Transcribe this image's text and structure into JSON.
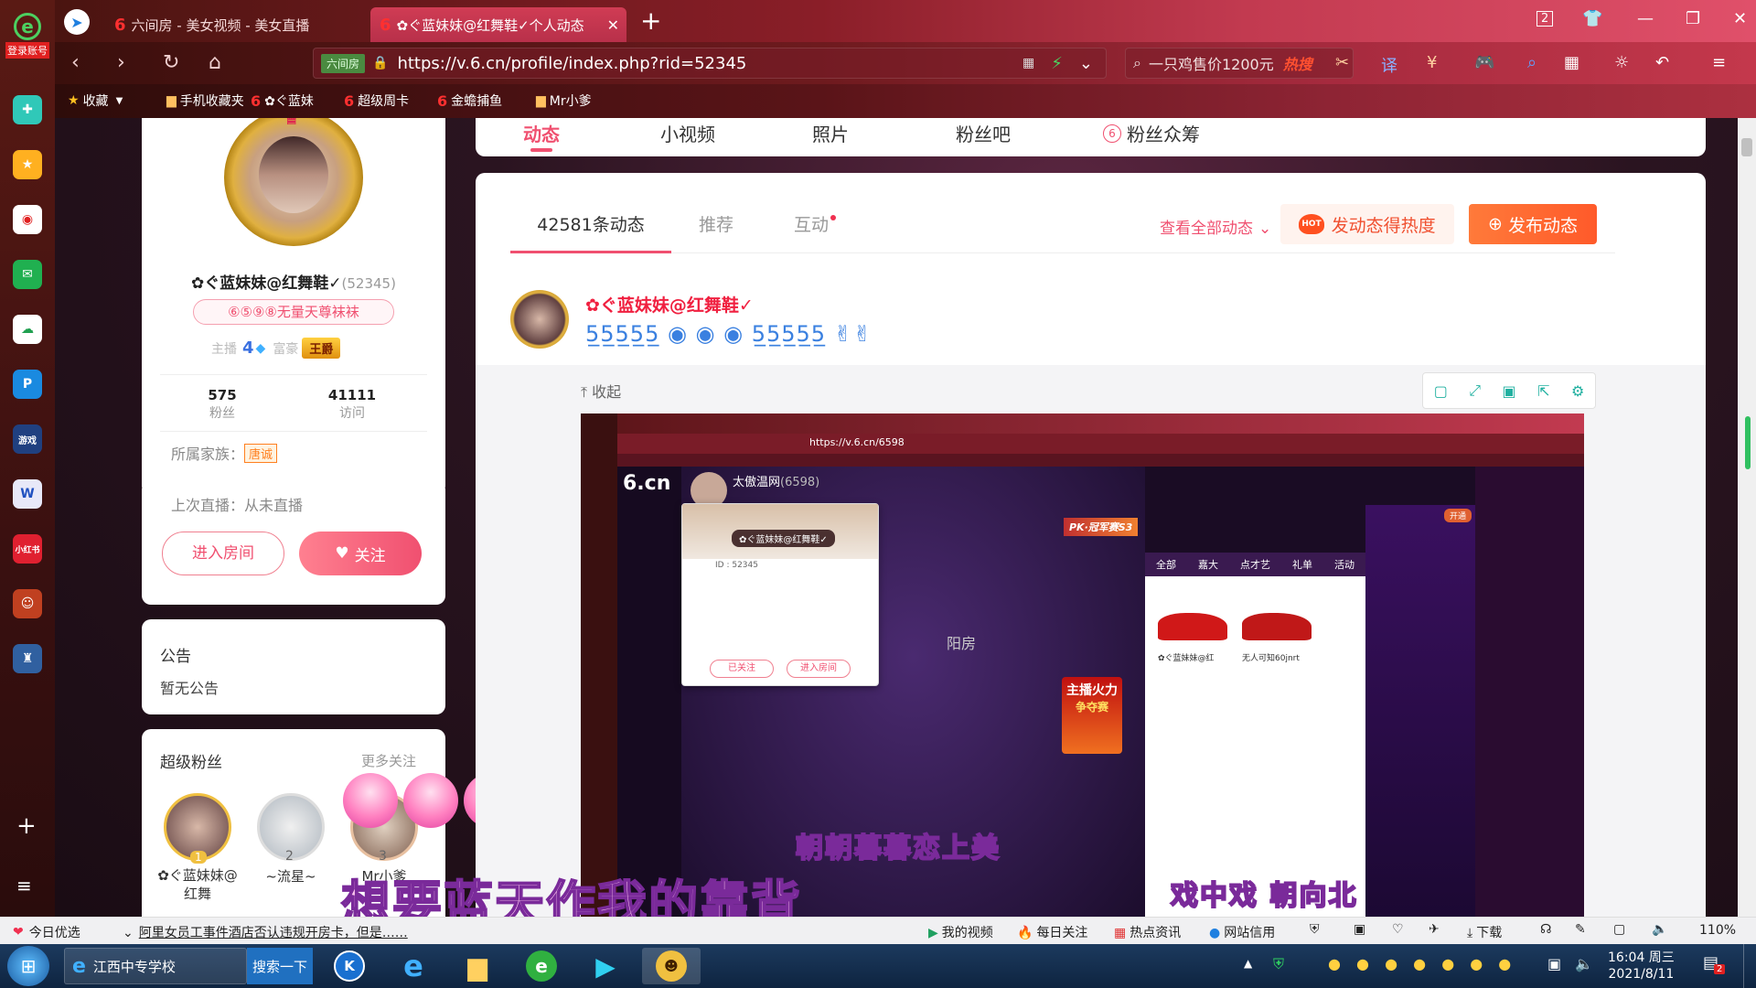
{
  "browser": {
    "logo_label": "登录账号",
    "tabs": [
      {
        "label": "六间房 - 美女视频 - 美女直播",
        "fav": "6"
      },
      {
        "label": "✿ぐ蓝妹妹@红舞鞋✓个人动态",
        "fav": "6"
      }
    ],
    "new_tab": "+",
    "window_count": "2",
    "address": {
      "badge": "六间房",
      "url": "https://v.6.cn/profile/index.php?rid=52345"
    },
    "search": {
      "placeholder": "一只鸡售价1200元",
      "hot": "热搜"
    },
    "bookmarks": [
      {
        "label": "收藏",
        "icon": "star-icon"
      },
      {
        "label": "手机收藏夹",
        "icon": "folder-icon"
      },
      {
        "label": "✿ぐ蓝妹",
        "six": true
      },
      {
        "label": "超级周卡",
        "six": true
      },
      {
        "label": "金蟾捕鱼",
        "six": true
      },
      {
        "label": "Mr小爹",
        "icon": "folder-icon"
      }
    ]
  },
  "profile_nav": {
    "tabs": [
      "动态",
      "小视频",
      "照片",
      "粉丝吧",
      "粉丝众筹"
    ],
    "active": 0
  },
  "profile": {
    "name": "✿ぐ蓝妹妹@红舞鞋✓",
    "rid": "(52345)",
    "title_badge": "⑥⑤⑨⑧无量天尊袜袜",
    "anchor_label": "主播",
    "anchor_level": "4",
    "rich_label": "富豪",
    "rich_badge": "王爵",
    "fans_count": "575",
    "fans_label": "粉丝",
    "visits_count": "41111",
    "visits_label": "访问",
    "family_label": "所属家族：",
    "family_badge": "唐诚",
    "last_live": "上次直播：从未直播",
    "enter_room": "进入房间",
    "follow": "关注"
  },
  "notice": {
    "title": "公告",
    "content": "暂无公告"
  },
  "super_fans": {
    "title": "超级粉丝",
    "more": "更多关注",
    "fans": [
      {
        "rank": "1",
        "name": "✿ぐ蓝妹妹@红舞"
      },
      {
        "rank": "2",
        "name": "~流星~"
      },
      {
        "rank": "3",
        "name": "Mr小爹"
      }
    ]
  },
  "feed": {
    "tabs": [
      "42581条动态",
      "推荐",
      "互动"
    ],
    "view_all": "查看全部动态",
    "hot_button": "发动态得热度",
    "hot_tag": "HOT",
    "publish_button": "发布动态",
    "post_author": "✿ぐ蓝妹妹@红舞鞋✓",
    "collapse": "收起"
  },
  "embedded": {
    "url": "https://v.6.cn/6598",
    "streamer_name": "太傲温网",
    "streamer_id": "(6598)",
    "popup_name": "✿ぐ蓝妹妹@红舞鞋✓",
    "popup_id": "ID : 52345",
    "popup_followed": "已关注",
    "popup_enter": "进入房间",
    "pk_label": "PK·冠军赛S3",
    "tabs": [
      "全部",
      "嘉大",
      "点才艺",
      "礼单",
      "活动"
    ],
    "gift1_name": "✿ぐ蓝妹妹@红",
    "gift2_name": "无人可知60jnrt",
    "fire_title": "主播火力",
    "fire_sub": "争夺赛",
    "chat_open": "开通",
    "channel_text": "阳房"
  },
  "lyrics": {
    "line1": "朝朝暮暮恋上美",
    "line2": "想要蓝天作我的靠背",
    "line3": "戏中戏 朝向北"
  },
  "status_bar": {
    "today_label": "今日优选",
    "news": "阿里女员工事件酒店否认违规开房卡，但是……",
    "items": [
      "我的视频",
      "每日关注",
      "热点资讯",
      "网站信用"
    ],
    "download": "下载",
    "zoom": "110%"
  },
  "taskbar": {
    "ie_label": "江西中专学校",
    "search_btn": "搜索一下",
    "time": "16:04 周三",
    "date": "2021/8/11",
    "notif_count": "2"
  },
  "colors": {
    "accent": "#f0506a",
    "brand_red": "#ff3030",
    "orange": "#ff7a3a"
  }
}
